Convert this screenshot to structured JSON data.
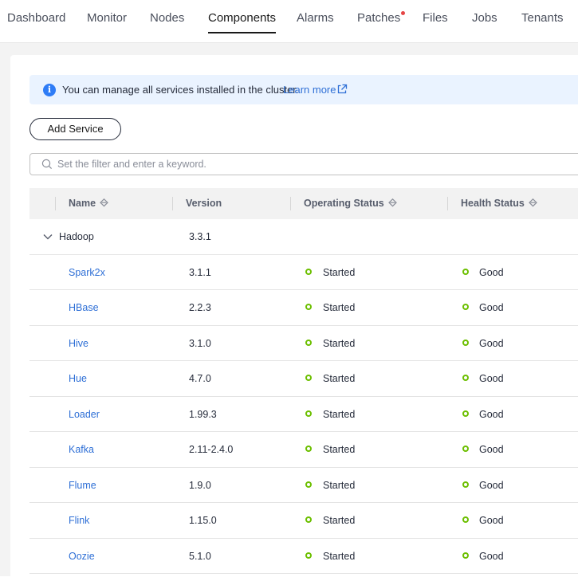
{
  "nav": {
    "tabs": [
      {
        "label": "Dashboard"
      },
      {
        "label": "Monitor"
      },
      {
        "label": "Nodes"
      },
      {
        "label": "Components"
      },
      {
        "label": "Alarms"
      },
      {
        "label": "Patches"
      },
      {
        "label": "Files"
      },
      {
        "label": "Jobs"
      },
      {
        "label": "Tenants"
      }
    ],
    "active": "Components",
    "badge_color": "#e54545"
  },
  "info": {
    "text": "You can manage all services installed in the cluster.",
    "link": "Learn more"
  },
  "toolbar": {
    "add_label": "Add Service"
  },
  "search": {
    "placeholder": "Set the filter and enter a keyword."
  },
  "table": {
    "columns": [
      "Name",
      "Version",
      "Operating Status",
      "Health Status"
    ],
    "group": {
      "name": "Hadoop",
      "version": "3.3.1"
    },
    "rows": [
      {
        "name": "Spark2x",
        "version": "3.1.1",
        "operating": "Started",
        "health": "Good"
      },
      {
        "name": "HBase",
        "version": "2.2.3",
        "operating": "Started",
        "health": "Good"
      },
      {
        "name": "Hive",
        "version": "3.1.0",
        "operating": "Started",
        "health": "Good"
      },
      {
        "name": "Hue",
        "version": "4.7.0",
        "operating": "Started",
        "health": "Good"
      },
      {
        "name": "Loader",
        "version": "1.99.3",
        "operating": "Started",
        "health": "Good"
      },
      {
        "name": "Kafka",
        "version": "2.11-2.4.0",
        "operating": "Started",
        "health": "Good"
      },
      {
        "name": "Flume",
        "version": "1.9.0",
        "operating": "Started",
        "health": "Good"
      },
      {
        "name": "Flink",
        "version": "1.15.0",
        "operating": "Started",
        "health": "Good"
      },
      {
        "name": "Oozie",
        "version": "5.1.0",
        "operating": "Started",
        "health": "Good"
      }
    ],
    "status_color": "#6cbf00"
  }
}
